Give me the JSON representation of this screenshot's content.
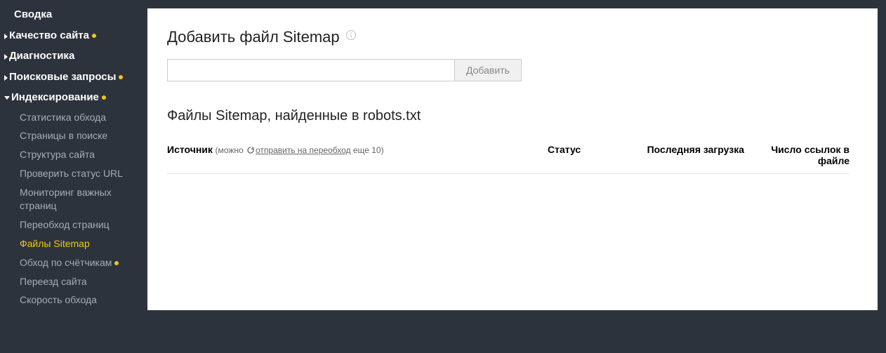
{
  "sidebar": {
    "summary": "Сводка",
    "quality": "Качество сайта",
    "diagnostics": "Диагностика",
    "queries": "Поисковые запросы",
    "indexing": "Индексирование",
    "sub": {
      "crawl_stats": "Статистика обхода",
      "pages_search": "Страницы в поиске",
      "site_structure": "Структура сайта",
      "check_url": "Проверить статус URL",
      "monitoring": "Мониторинг важных страниц",
      "recrawl": "Переобход страниц",
      "sitemaps": "Файлы Sitemap",
      "counters": "Обход по счётчикам",
      "moving": "Переезд сайта",
      "crawl_speed": "Скорость обхода"
    }
  },
  "main": {
    "add_title": "Добавить файл Sitemap",
    "add_button": "Добавить",
    "robots_title": "Файлы Sitemap, найденные в robots.txt",
    "col_source": "Источник",
    "meta_prefix": "(можно ",
    "meta_link": "отправить на переобход",
    "meta_suffix": " еще 10)",
    "col_status": "Статус",
    "col_date": "Последняя загрузка",
    "col_count": "Число ссылок в файле"
  }
}
